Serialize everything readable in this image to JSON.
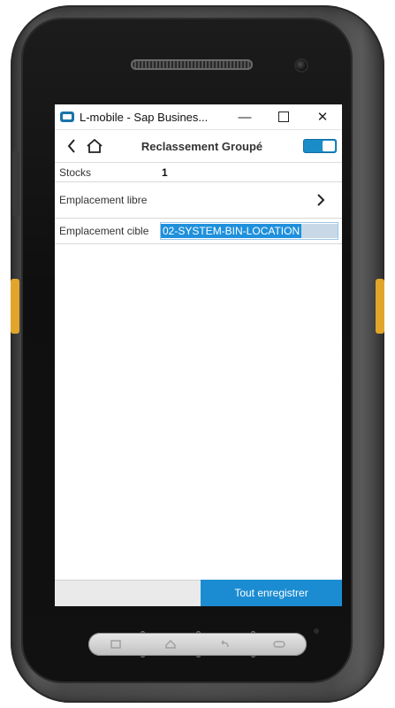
{
  "window": {
    "title": "L-mobile - Sap Busines...",
    "minimize_glyph": "—",
    "close_glyph": "✕"
  },
  "toolbar": {
    "title": "Reclassement Groupé",
    "back_icon": "chevron-left-icon",
    "home_icon": "home-icon",
    "toggle_state": "on"
  },
  "form": {
    "stocks": {
      "label": "Stocks",
      "value": "1"
    },
    "emplacement_libre": {
      "label": "Emplacement libre"
    },
    "emplacement_cible": {
      "label": "Emplacement cible",
      "value": "02-SYSTEM-BIN-LOCATION"
    }
  },
  "footer": {
    "save_all_label": "Tout enregistrer"
  },
  "colors": {
    "accent": "#1b8cd2",
    "selection": "#1e90dc",
    "device_accent": "#e0a52a"
  }
}
